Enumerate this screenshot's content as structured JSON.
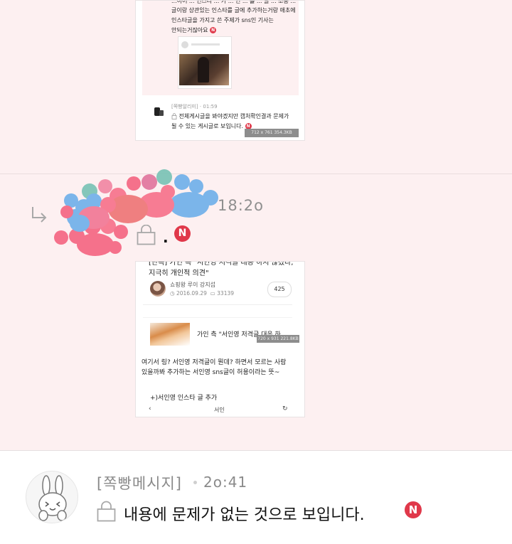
{
  "top_screenshot": {
    "line1": "...이어 ... 인스타 ... 가 ... 인 ... 를 ... 글 ... 소통 ...",
    "line2": "글이랑 상관있는 인스타를 글에 추가하는거랑 애초에",
    "line3": "인스타글을 가지고 쓴 주제가 sns인 기사는",
    "line4": "안되는거잖아요",
    "sender": "[쪽빵알리미]",
    "time": "01:59",
    "reply_line1": "전체게시글을 봐야겠지만 캡처확인결과 문제가",
    "reply_line2": "될 수 있는 게시글로 보입니다.",
    "dimensions": "712 x 761  354.3KB"
  },
  "middle_message": {
    "time": "18:2o",
    "text": ".",
    "screenshot": {
      "headline1": "[단독] 가인 측 \"서인영 저격글 대응 하지 않겠다,",
      "headline2": "지극히 개인적 의견\"",
      "author": "쇼핑왕 루이 강지섭",
      "date": "2016.09.29",
      "views": "33139",
      "comments": "425",
      "sub_title": "가인 측 \"서인영 저격글 대응 하",
      "dimensions": "720 x 931  221.8KB",
      "body1": "여기서 링? 서인영 저격글이 뭔데? 하면서 모르는 사람",
      "body2": "있을까봐 추가하는 서인영 sns글이 허용이라는 뜻~",
      "body3": "+)서인영 인스타 글 추가",
      "nav_center": "서인"
    }
  },
  "bottom_message": {
    "sender": "[쪽빵메시지]",
    "time": "2o:41",
    "text": "내용에 문제가 없는 것으로 보입니다."
  },
  "badge_letter": "N",
  "colors": {
    "background": "#fdf0f1",
    "badge": "#e0384a",
    "muted_text": "#8f8f8f"
  },
  "icons": [
    "lock-icon",
    "reply-arrow-icon",
    "new-badge-icon",
    "rabbit-avatar-icon"
  ]
}
